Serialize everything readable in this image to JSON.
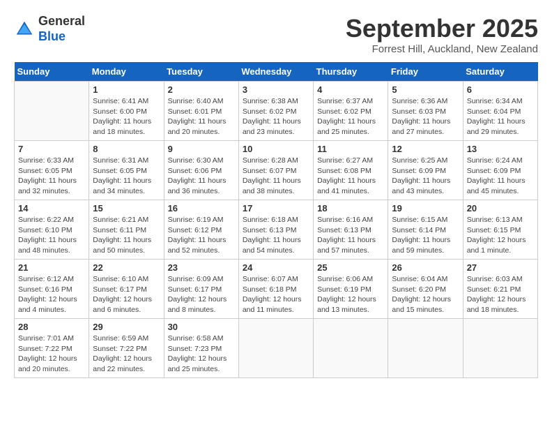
{
  "header": {
    "logo_general": "General",
    "logo_blue": "Blue",
    "month_title": "September 2025",
    "location": "Forrest Hill, Auckland, New Zealand"
  },
  "calendar": {
    "days_of_week": [
      "Sunday",
      "Monday",
      "Tuesday",
      "Wednesday",
      "Thursday",
      "Friday",
      "Saturday"
    ],
    "weeks": [
      [
        {
          "day": "",
          "info": ""
        },
        {
          "day": "1",
          "info": "Sunrise: 6:41 AM\nSunset: 6:00 PM\nDaylight: 11 hours\nand 18 minutes."
        },
        {
          "day": "2",
          "info": "Sunrise: 6:40 AM\nSunset: 6:01 PM\nDaylight: 11 hours\nand 20 minutes."
        },
        {
          "day": "3",
          "info": "Sunrise: 6:38 AM\nSunset: 6:02 PM\nDaylight: 11 hours\nand 23 minutes."
        },
        {
          "day": "4",
          "info": "Sunrise: 6:37 AM\nSunset: 6:02 PM\nDaylight: 11 hours\nand 25 minutes."
        },
        {
          "day": "5",
          "info": "Sunrise: 6:36 AM\nSunset: 6:03 PM\nDaylight: 11 hours\nand 27 minutes."
        },
        {
          "day": "6",
          "info": "Sunrise: 6:34 AM\nSunset: 6:04 PM\nDaylight: 11 hours\nand 29 minutes."
        }
      ],
      [
        {
          "day": "7",
          "info": "Sunrise: 6:33 AM\nSunset: 6:05 PM\nDaylight: 11 hours\nand 32 minutes."
        },
        {
          "day": "8",
          "info": "Sunrise: 6:31 AM\nSunset: 6:05 PM\nDaylight: 11 hours\nand 34 minutes."
        },
        {
          "day": "9",
          "info": "Sunrise: 6:30 AM\nSunset: 6:06 PM\nDaylight: 11 hours\nand 36 minutes."
        },
        {
          "day": "10",
          "info": "Sunrise: 6:28 AM\nSunset: 6:07 PM\nDaylight: 11 hours\nand 38 minutes."
        },
        {
          "day": "11",
          "info": "Sunrise: 6:27 AM\nSunset: 6:08 PM\nDaylight: 11 hours\nand 41 minutes."
        },
        {
          "day": "12",
          "info": "Sunrise: 6:25 AM\nSunset: 6:09 PM\nDaylight: 11 hours\nand 43 minutes."
        },
        {
          "day": "13",
          "info": "Sunrise: 6:24 AM\nSunset: 6:09 PM\nDaylight: 11 hours\nand 45 minutes."
        }
      ],
      [
        {
          "day": "14",
          "info": "Sunrise: 6:22 AM\nSunset: 6:10 PM\nDaylight: 11 hours\nand 48 minutes."
        },
        {
          "day": "15",
          "info": "Sunrise: 6:21 AM\nSunset: 6:11 PM\nDaylight: 11 hours\nand 50 minutes."
        },
        {
          "day": "16",
          "info": "Sunrise: 6:19 AM\nSunset: 6:12 PM\nDaylight: 11 hours\nand 52 minutes."
        },
        {
          "day": "17",
          "info": "Sunrise: 6:18 AM\nSunset: 6:13 PM\nDaylight: 11 hours\nand 54 minutes."
        },
        {
          "day": "18",
          "info": "Sunrise: 6:16 AM\nSunset: 6:13 PM\nDaylight: 11 hours\nand 57 minutes."
        },
        {
          "day": "19",
          "info": "Sunrise: 6:15 AM\nSunset: 6:14 PM\nDaylight: 11 hours\nand 59 minutes."
        },
        {
          "day": "20",
          "info": "Sunrise: 6:13 AM\nSunset: 6:15 PM\nDaylight: 12 hours\nand 1 minute."
        }
      ],
      [
        {
          "day": "21",
          "info": "Sunrise: 6:12 AM\nSunset: 6:16 PM\nDaylight: 12 hours\nand 4 minutes."
        },
        {
          "day": "22",
          "info": "Sunrise: 6:10 AM\nSunset: 6:17 PM\nDaylight: 12 hours\nand 6 minutes."
        },
        {
          "day": "23",
          "info": "Sunrise: 6:09 AM\nSunset: 6:17 PM\nDaylight: 12 hours\nand 8 minutes."
        },
        {
          "day": "24",
          "info": "Sunrise: 6:07 AM\nSunset: 6:18 PM\nDaylight: 12 hours\nand 11 minutes."
        },
        {
          "day": "25",
          "info": "Sunrise: 6:06 AM\nSunset: 6:19 PM\nDaylight: 12 hours\nand 13 minutes."
        },
        {
          "day": "26",
          "info": "Sunrise: 6:04 AM\nSunset: 6:20 PM\nDaylight: 12 hours\nand 15 minutes."
        },
        {
          "day": "27",
          "info": "Sunrise: 6:03 AM\nSunset: 6:21 PM\nDaylight: 12 hours\nand 18 minutes."
        }
      ],
      [
        {
          "day": "28",
          "info": "Sunrise: 7:01 AM\nSunset: 7:22 PM\nDaylight: 12 hours\nand 20 minutes."
        },
        {
          "day": "29",
          "info": "Sunrise: 6:59 AM\nSunset: 7:22 PM\nDaylight: 12 hours\nand 22 minutes."
        },
        {
          "day": "30",
          "info": "Sunrise: 6:58 AM\nSunset: 7:23 PM\nDaylight: 12 hours\nand 25 minutes."
        },
        {
          "day": "",
          "info": ""
        },
        {
          "day": "",
          "info": ""
        },
        {
          "day": "",
          "info": ""
        },
        {
          "day": "",
          "info": ""
        }
      ]
    ]
  }
}
